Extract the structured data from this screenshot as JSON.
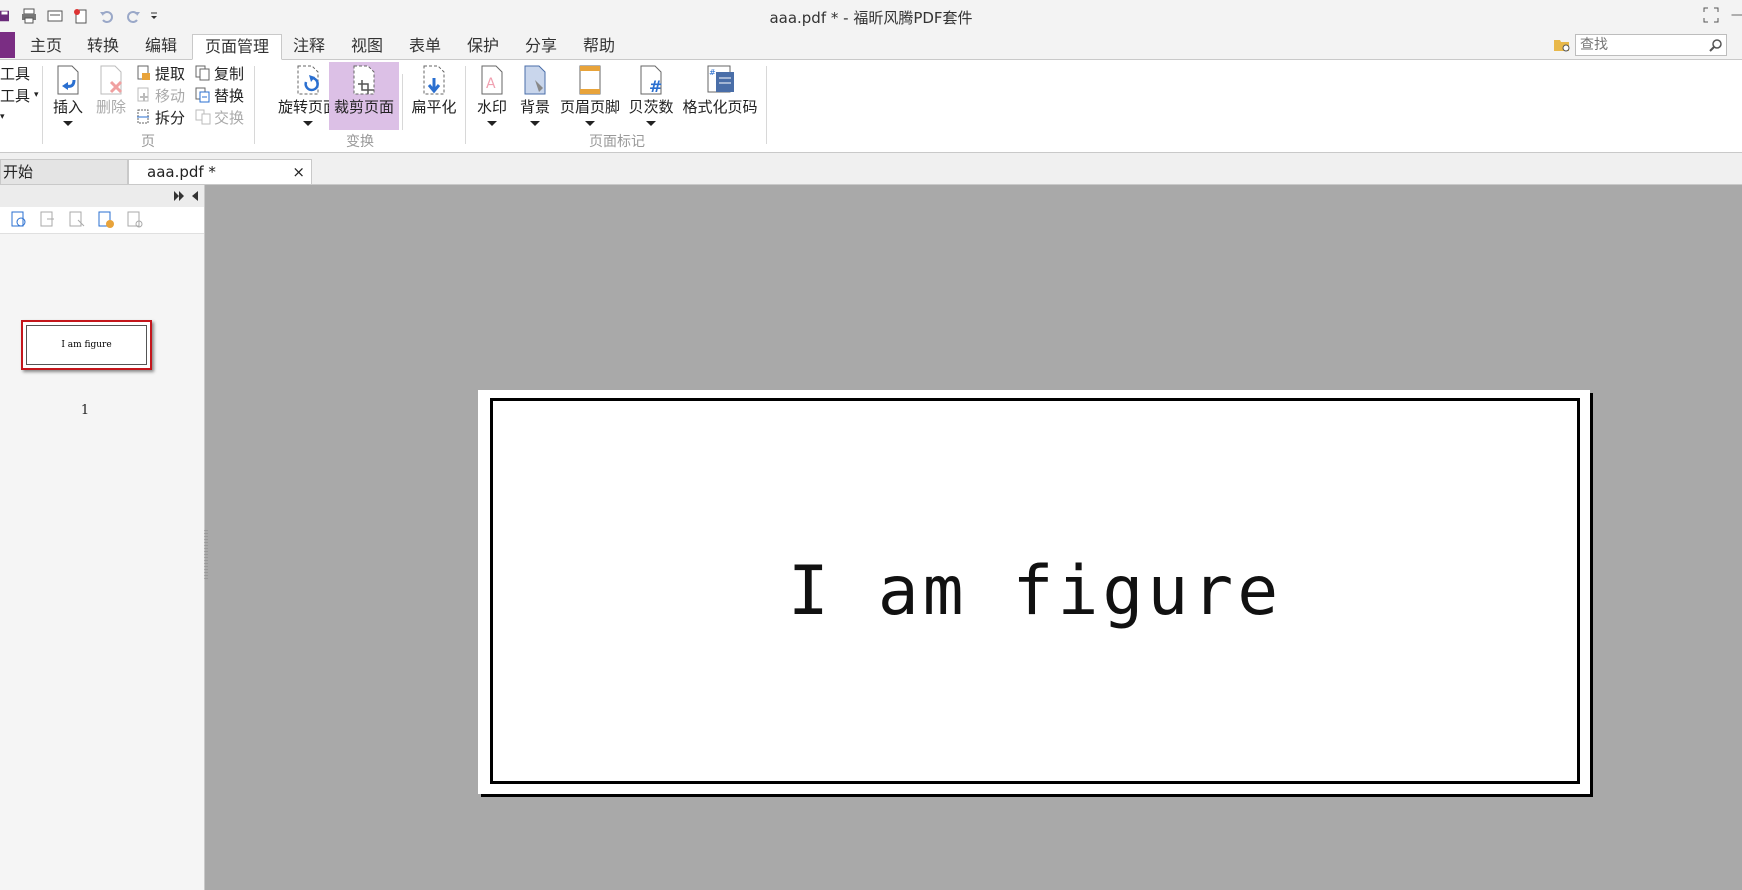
{
  "window": {
    "title": "aaa.pdf * - 福昕风腾PDF套件"
  },
  "ribbon_tabs": [
    {
      "label": "主页"
    },
    {
      "label": "转换"
    },
    {
      "label": "编辑"
    },
    {
      "label": "页面管理",
      "active": true
    },
    {
      "label": "注释"
    },
    {
      "label": "视图"
    },
    {
      "label": "表单"
    },
    {
      "label": "保护"
    },
    {
      "label": "分享"
    },
    {
      "label": "帮助"
    }
  ],
  "search": {
    "placeholder": "查找"
  },
  "ribbon": {
    "left_partial": {
      "tool1": "工具",
      "tool2": "工具"
    },
    "page_group": {
      "label": "页",
      "insert": "插入",
      "delete": "删除",
      "extract": "提取",
      "move": "移动",
      "split": "拆分",
      "copy": "复制",
      "replace": "替换",
      "swap": "交换"
    },
    "transform_group": {
      "label": "变换",
      "rotate": "旋转页面",
      "crop": "裁剪页面",
      "flatten": "扁平化"
    },
    "mark_group": {
      "label": "页面标记",
      "watermark": "水印",
      "background": "背景",
      "header_footer": "页眉页脚",
      "bates": "贝茨数",
      "format_page_number": "格式化页码"
    }
  },
  "doc_tabs": {
    "start": "开始",
    "file": "aaa.pdf *",
    "close": "×"
  },
  "thumbnail": {
    "text": "I am figure",
    "page_number": "1"
  },
  "document": {
    "text": "I am figure"
  },
  "colors": {
    "accent": "#7a2d83",
    "selected_button": "#dcc0e6",
    "thumb_border": "#c4161c",
    "workspace": "#a9a9a9"
  }
}
